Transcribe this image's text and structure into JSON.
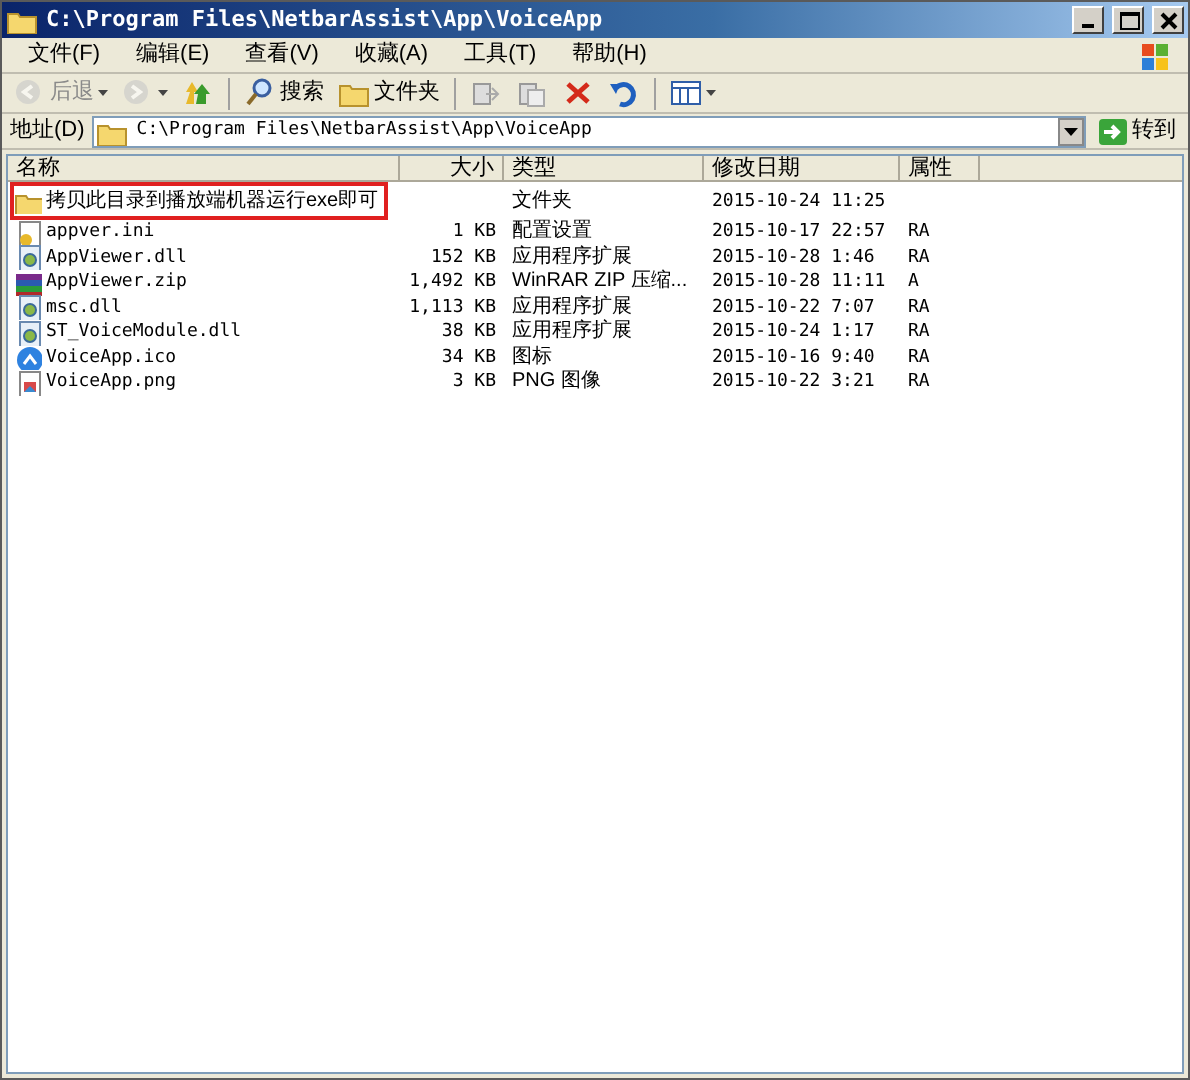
{
  "window": {
    "title": "C:\\Program Files\\NetbarAssist\\App\\VoiceApp"
  },
  "menu": [
    "文件(F)",
    "编辑(E)",
    "查看(V)",
    "收藏(A)",
    "工具(T)",
    "帮助(H)"
  ],
  "toolbar": [
    {
      "kind": "back",
      "label": "后退",
      "disabled": true
    },
    {
      "kind": "forward",
      "disabled": true
    },
    {
      "kind": "up"
    },
    {
      "kind": "search",
      "label": "搜索"
    },
    {
      "kind": "folders",
      "label": "文件夹"
    },
    {
      "kind": "move"
    },
    {
      "kind": "copy"
    },
    {
      "kind": "delete"
    },
    {
      "kind": "undo"
    },
    {
      "kind": "views"
    }
  ],
  "address": {
    "label": "地址(D)",
    "value": "C:\\Program Files\\NetbarAssist\\App\\VoiceApp",
    "go": "转到"
  },
  "table": {
    "columns": [
      "名称",
      "大小",
      "类型",
      "修改日期",
      "属性"
    ],
    "rows": [
      {
        "kind": "folder",
        "annotated": true,
        "cells": [
          "拷贝此目录到播放端机器运行exe即可",
          "",
          "文件夹",
          "2015-10-24 11:25",
          ""
        ]
      },
      {
        "kind": "ini",
        "annotated": false,
        "cells": [
          "appver.ini",
          "1 KB",
          "配置设置",
          "2015-10-17 22:57",
          "RA"
        ]
      },
      {
        "kind": "dll",
        "annotated": false,
        "cells": [
          "AppViewer.dll",
          "152 KB",
          "应用程序扩展",
          "2015-10-28 1:46",
          "RA"
        ]
      },
      {
        "kind": "zip",
        "annotated": false,
        "cells": [
          "AppViewer.zip",
          "1,492 KB",
          "WinRAR ZIP 压缩...",
          "2015-10-28 11:11",
          "A"
        ]
      },
      {
        "kind": "dll",
        "annotated": false,
        "cells": [
          "msc.dll",
          "1,113 KB",
          "应用程序扩展",
          "2015-10-22 7:07",
          "RA"
        ]
      },
      {
        "kind": "dll",
        "annotated": false,
        "cells": [
          "ST_VoiceModule.dll",
          "38 KB",
          "应用程序扩展",
          "2015-10-24 1:17",
          "RA"
        ]
      },
      {
        "kind": "ico",
        "annotated": false,
        "cells": [
          "VoiceApp.ico",
          "34 KB",
          "图标",
          "2015-10-16 9:40",
          "RA"
        ]
      },
      {
        "kind": "png",
        "annotated": false,
        "cells": [
          "VoiceApp.png",
          "3 KB",
          "PNG 图像",
          "2015-10-22 3:21",
          "RA"
        ]
      }
    ]
  }
}
